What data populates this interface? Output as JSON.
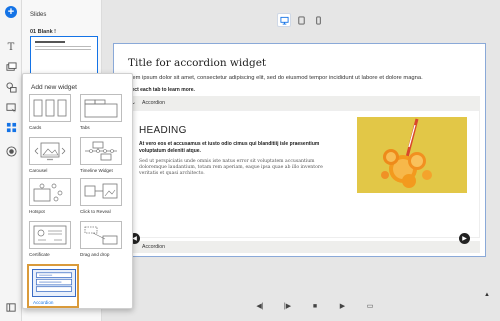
{
  "slides_panel": {
    "title": "Slides",
    "slide_label": "01 Blank !"
  },
  "icons": {
    "add": "plus-circle-icon",
    "text": "text-icon",
    "media": "media-icon",
    "shapes": "shapes-icon",
    "interactions": "interactions-icon",
    "widgets": "widgets-icon",
    "record": "record-icon",
    "bottom": "slides-icon"
  },
  "devices": [
    "desktop",
    "tablet",
    "mobile"
  ],
  "slide": {
    "title": "Title for accordion widget",
    "body": "Lorem ipsum dolor sit amet, consectetur adipiscing elit, sed do eiusmod tempor incididunt ut labore et dolore magna.",
    "hint": "Select each tab to learn more.",
    "accordion_1": "Accordion",
    "accordion_2": "Accordion",
    "panel_heading": "HEADING",
    "panel_bold": "At vero eos et accusamus et iusto odio cimus qui blanditiij isle praesentium voluptatum deleniti atque.",
    "panel_small": "Sed ut perspiciatis unde omnis iste natus error sit voluptatem accusantium doloremque laudantium, totam rem aperiam, eaque ipsa quae ab illo inventore veritatis et quasi architecto."
  },
  "popup": {
    "title": "Add new widget",
    "widgets": [
      {
        "label": "Cards"
      },
      {
        "label": "Tabs"
      },
      {
        "label": "Carousel"
      },
      {
        "label": "Timeline Widget"
      },
      {
        "label": "Hotspot"
      },
      {
        "label": "Click to Reveal"
      },
      {
        "label": "Certificate"
      },
      {
        "label": "Drag and drop"
      },
      {
        "label": "Accordion"
      }
    ],
    "selected": "Accordion"
  },
  "colors": {
    "accent": "#1473e6",
    "selection": "#d99a3a",
    "image_bg": "#e2c747"
  }
}
